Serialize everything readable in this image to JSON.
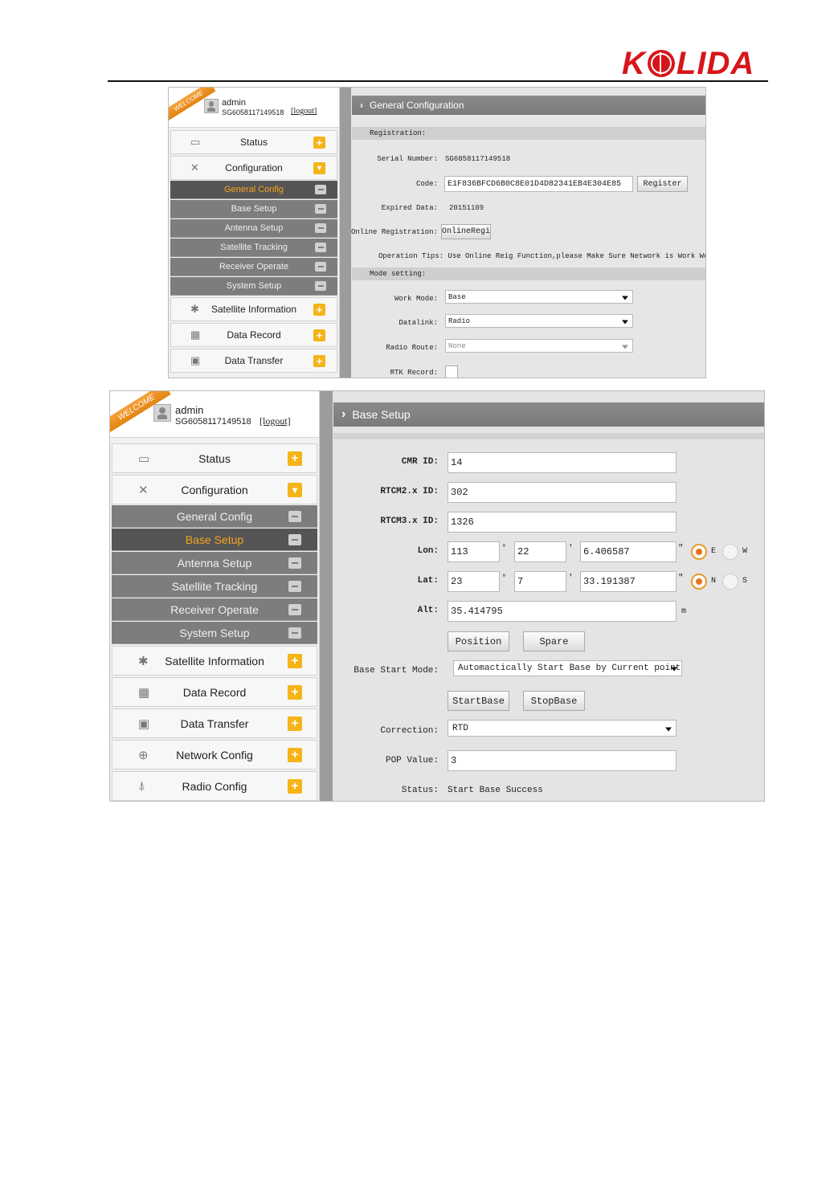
{
  "brand": {
    "logo_text_left": "K",
    "logo_text_right": "LIDA"
  },
  "common": {
    "welcome": "WELCOME",
    "user": "admin",
    "serial": "SG6058117149518",
    "logout": "[logout]"
  },
  "shot1": {
    "menu": {
      "status": "Status",
      "configuration": "Configuration",
      "subs": [
        "General Config",
        "Base Setup",
        "Antenna Setup",
        "Satellite Tracking",
        "Receiver Operate",
        "System Setup"
      ],
      "satellite_information": "Satellite Information",
      "data_record": "Data Record",
      "data_transfer": "Data Transfer"
    },
    "title": "General Configuration",
    "registration": {
      "section": "Registration:",
      "serial_label": "Serial Number:",
      "serial_value": "SG6058117149518",
      "code_label": "Code:",
      "code_value": "E1F836BFCD6B0C8E01D4D82341EB4E304E85",
      "register_button": "Register",
      "expired_label": "Expired Data:",
      "expired_value": "20151109",
      "online_label": "Online Registration:",
      "online_button": "OnlineRegi",
      "tips": "Operation Tips: Use Online Reig Function,please Make Sure Network is Work Well!"
    },
    "mode": {
      "section": "Mode setting:",
      "work_mode_label": "Work Mode:",
      "work_mode_value": "Base",
      "datalink_label": "Datalink:",
      "datalink_value": "Radio",
      "radio_route_label": "Radio Route:",
      "radio_route_value": "None",
      "rtk_record_label": "RTK Record:"
    }
  },
  "shot2": {
    "menu": {
      "status": "Status",
      "configuration": "Configuration",
      "subs": [
        "General Config",
        "Base Setup",
        "Antenna Setup",
        "Satellite Tracking",
        "Receiver Operate",
        "System Setup"
      ],
      "satellite_information": "Satellite Information",
      "data_record": "Data Record",
      "data_transfer": "Data Transfer",
      "network_config": "Network Config",
      "radio_config": "Radio Config"
    },
    "title": "Base Setup",
    "form": {
      "cmr_label": "CMR ID:",
      "cmr_value": "14",
      "rtcm2_label": "RTCM2.x ID:",
      "rtcm2_value": "302",
      "rtcm3_label": "RTCM3.x ID:",
      "rtcm3_value": "1326",
      "lon_label": "Lon:",
      "lon_deg": "113",
      "lon_min": "22",
      "lon_sec": "6.406587",
      "lat_label": "Lat:",
      "lat_deg": "23",
      "lat_min": "7",
      "lat_sec": "33.191387",
      "deg_sym": "°",
      "min_sym": "′",
      "sec_sym": "″",
      "east": "E",
      "west": "W",
      "north": "N",
      "south": "S",
      "alt_label": "Alt:",
      "alt_value": "35.414795",
      "alt_unit": "m",
      "position_button": "Position",
      "spare_button": "Spare",
      "start_mode_label": "Base Start Mode:",
      "start_mode_value": "Automactically Start Base by Current point",
      "startbase_button": "StartBase",
      "stopbase_button": "StopBase",
      "correction_label": "Correction:",
      "correction_value": "RTD",
      "pop_label": "POP Value:",
      "pop_value": "3",
      "status_label": "Status:",
      "status_value": "Start Base Success"
    }
  }
}
